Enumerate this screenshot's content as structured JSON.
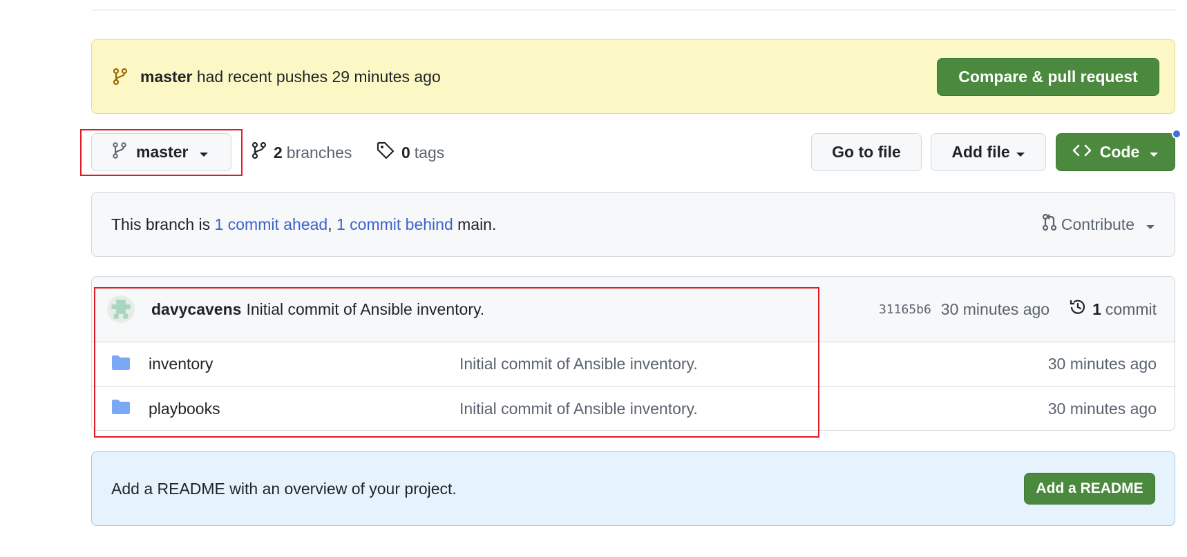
{
  "banner": {
    "branch": "master",
    "message": " had recent pushes 29 minutes ago",
    "compare_button": "Compare & pull request"
  },
  "toolbar": {
    "branch_selector": "master",
    "branches_count": "2",
    "branches_label": "branches",
    "tags_count": "0",
    "tags_label": "tags",
    "go_to_file": "Go to file",
    "add_file": "Add file",
    "code": "Code"
  },
  "branch_status": {
    "prefix": "This branch is ",
    "ahead": "1 commit ahead",
    "separator": ", ",
    "behind": "1 commit behind",
    "suffix": " main.",
    "contribute": "Contribute"
  },
  "latest_commit": {
    "author": "davycavens",
    "message": "Initial commit of Ansible inventory.",
    "sha": "31165b6",
    "age": "30 minutes ago",
    "commit_count": "1",
    "commit_label": "commit"
  },
  "files": [
    {
      "name": "inventory",
      "message": "Initial commit of Ansible inventory.",
      "age": "30 minutes ago",
      "icon": "folder-icon"
    },
    {
      "name": "playbooks",
      "message": "Initial commit of Ansible inventory.",
      "age": "30 minutes ago",
      "icon": "folder-icon"
    }
  ],
  "readme": {
    "text": "Add a README with an overview of your project.",
    "button": "Add a README"
  },
  "colors": {
    "green": "#4b8a3e",
    "link": "#3e63c9",
    "banner_bg": "#fbf8c5",
    "readme_bg": "#e6f3fd",
    "highlight": "#e01b24"
  }
}
